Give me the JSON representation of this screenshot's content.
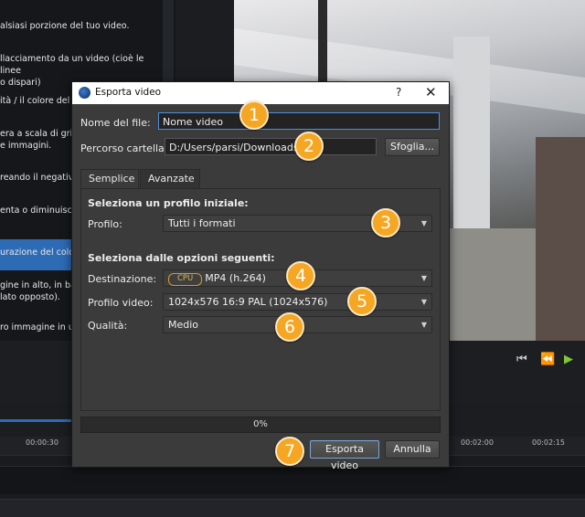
{
  "background": {
    "effects_list": [
      {
        "text": "alsiasi porzione del tuo video.",
        "selected": false
      },
      {
        "text": "llacciamento da un video (cioè le linee\no dispari)",
        "selected": false
      },
      {
        "text": "ità / il colore del qu",
        "selected": false
      },
      {
        "text": "era a scala di grigi\ne immagini.",
        "selected": false
      },
      {
        "text": "reando il negativo",
        "selected": false
      },
      {
        "text": "enta o diminuisce)",
        "selected": false
      },
      {
        "text": "urazione del colore.",
        "selected": true
      },
      {
        "text": "gine in alto, in basso\nlato opposto).",
        "selected": false
      },
      {
        "text": "ro immagine in un",
        "selected": false
      }
    ],
    "transport": {
      "rewind_start": "⏮",
      "rewind": "⏪",
      "play": "▶"
    },
    "timeline_ticks": [
      "00:00:30",
      "00:02:00",
      "00:02:15"
    ]
  },
  "dialog": {
    "title": "Esporta video",
    "help_label": "?",
    "close_label": "✕",
    "filename_label": "Nome del file:",
    "filename_value": "Nome video",
    "folder_label": "Percorso cartella:",
    "folder_value": "D:/Users/parsi/Downloads",
    "browse_label": "Sfoglia...",
    "tabs": [
      {
        "label": "Semplice",
        "active": true
      },
      {
        "label": "Avanzate",
        "active": false
      }
    ],
    "section1_title": "Seleziona un profilo iniziale:",
    "profile_label": "Profilo:",
    "profile_value": "Tutti i formati",
    "section2_title": "Seleziona dalle opzioni seguenti:",
    "destination_label": "Destinazione:",
    "destination_badge": "CPU",
    "destination_value": "MP4 (h.264)",
    "video_profile_label": "Profilo video:",
    "video_profile_value": "1024x576 16:9 PAL (1024x576)",
    "quality_label": "Qualità:",
    "quality_value": "Medio",
    "progress_text": "0%",
    "export_label": "Esporta video",
    "cancel_label": "Annulla"
  },
  "annotations": [
    "1",
    "2",
    "3",
    "4",
    "5",
    "6",
    "7"
  ],
  "colors": {
    "accent": "#f5a623",
    "selection": "#2d6bb5",
    "focus": "#4a90e2"
  }
}
